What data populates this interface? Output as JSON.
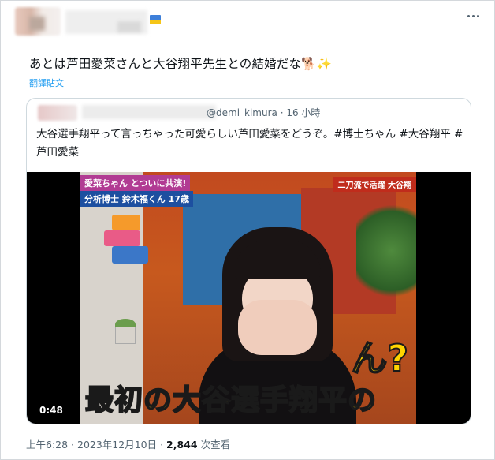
{
  "tweet": {
    "text": "あとは芦田愛菜さんと大谷翔平先生との結婚だな🐕✨",
    "translate_label": "翻譯貼文"
  },
  "quote": {
    "handle_time": "@demi_kimura · 16 小時",
    "text": "大谷選手翔平って言っちゃった可愛らしい芦田愛菜をどうぞ。#博士ちゃん #大谷翔平 #芦田愛菜",
    "video": {
      "duration": "0:48",
      "tele_top": "愛菜ちゃん とついに共演!",
      "tele_top2": "分析博士 鈴木福くん 17歳",
      "tele_right": "二刀流で活躍 大谷翔",
      "caption": "最初の大谷選手翔平の",
      "side_glyph": "ん?"
    }
  },
  "footer": {
    "timestamp": "上午6:28 · 2023年12月10日 · ",
    "views_count": "2,844",
    "views_label": " 次查看"
  },
  "colors": {
    "link": "#1d9bf0",
    "muted": "#536471",
    "text": "#0f1419"
  },
  "icons": [
    "more-icon",
    "ukraine-flag-icon"
  ]
}
